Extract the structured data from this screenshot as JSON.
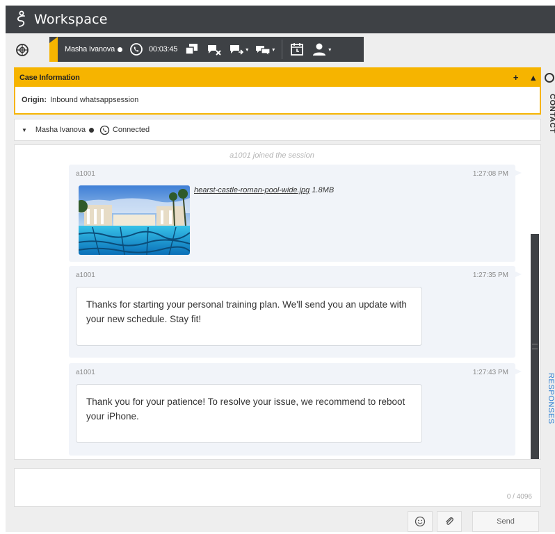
{
  "app": {
    "title": "Workspace"
  },
  "interaction": {
    "party_name": "Masha Ivanova",
    "timer": "00:03:45"
  },
  "case": {
    "header": "Case Information",
    "add_symbol": "+",
    "collapse_symbol": "▴",
    "origin_label": "Origin:",
    "origin_value": "Inbound whatsappsession"
  },
  "side_tabs": {
    "contact": "CONTACT",
    "responses": "RESPONSES"
  },
  "party_row": {
    "name": "Masha Ivanova",
    "status": "Connected"
  },
  "transcript": {
    "system_message": "a1001 joined the session",
    "messages": [
      {
        "sender": "a1001",
        "time": "1:27:08 PM",
        "attachment_name": "hearst-castle-roman-pool-wide.jpg",
        "attachment_size": "1.8MB"
      },
      {
        "sender": "a1001",
        "time": "1:27:35 PM",
        "text": "Thanks for starting your personal training plan. We'll send you an update with your new schedule. Stay fit!"
      },
      {
        "sender": "a1001",
        "time": "1:27:43 PM",
        "text": "Thank you for your patience! To resolve your issue, we recommend to reboot your iPhone."
      }
    ]
  },
  "composer": {
    "counter": "0 / 4096",
    "send_label": "Send"
  },
  "colors": {
    "accent": "#f6b400",
    "dark": "#3e4145",
    "link": "#2d7fd1"
  }
}
